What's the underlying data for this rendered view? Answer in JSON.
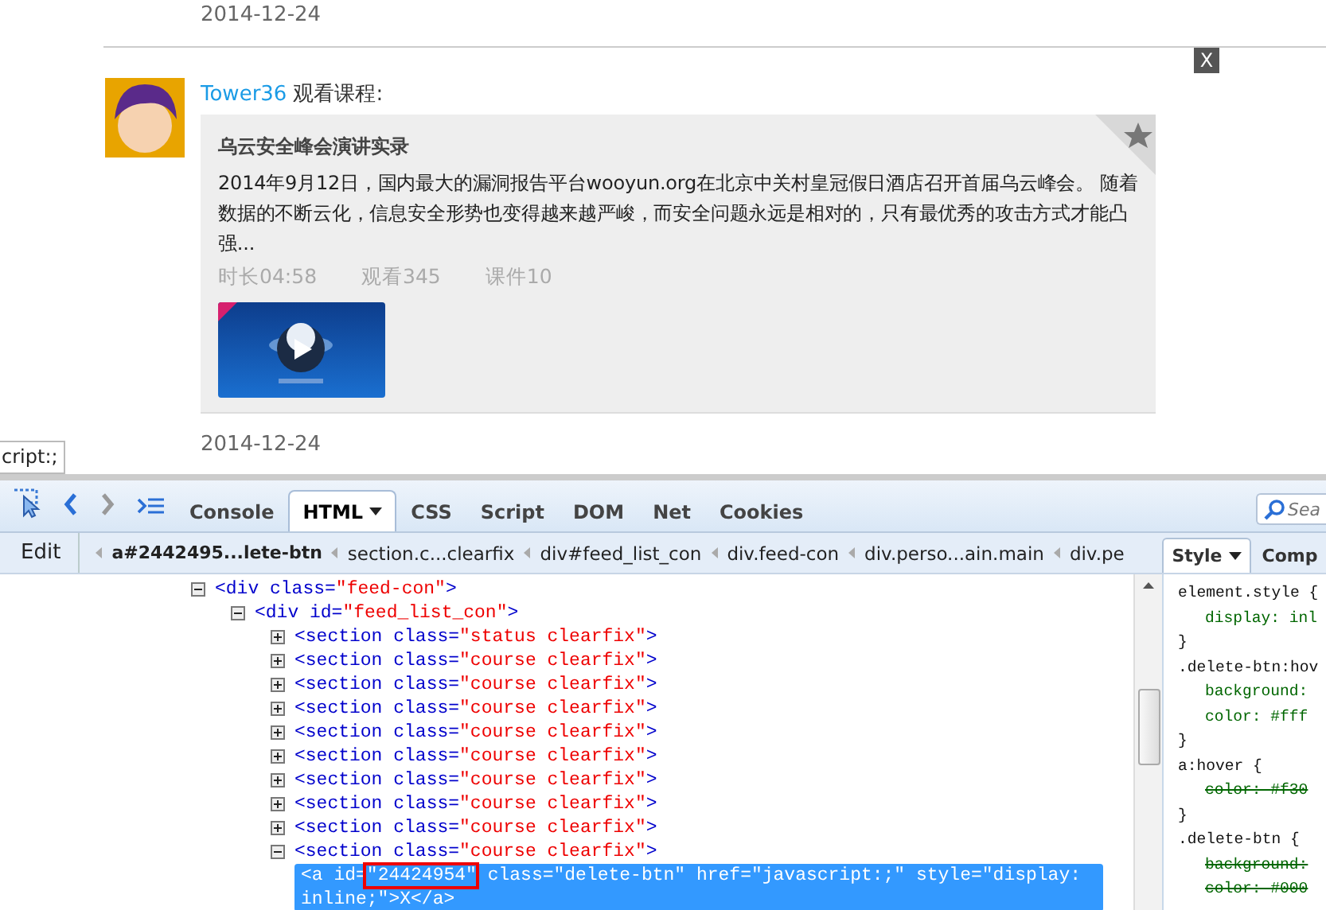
{
  "page": {
    "date_top": "2014-12-24",
    "close_label": "X",
    "feed": {
      "user": "Tower36",
      "action": "观看课程:",
      "course": {
        "title": "乌云安全峰会演讲实录",
        "description": "2014年9月12日，国内最大的漏洞报告平台wooyun.org在北京中关村皇冠假日酒店召开首届乌云峰会。 随着数据的不断云化，信息安全形势也变得越来越严峻，而安全问题永远是相对的，只有最优秀的攻击方式才能凸强...",
        "stats": [
          "时长04:58",
          "观看345",
          "课件10"
        ],
        "thumbnail": {
          "kind": "picture"
        }
      }
    },
    "date_bottom": "2014-12-24",
    "tooltip": "cript:;"
  },
  "devtools": {
    "tabs": [
      {
        "label": "Console",
        "selected": false,
        "menu": false
      },
      {
        "label": "HTML",
        "selected": true,
        "menu": true
      },
      {
        "label": "CSS",
        "selected": false,
        "menu": false
      },
      {
        "label": "Script",
        "selected": false,
        "menu": false
      },
      {
        "label": "DOM",
        "selected": false,
        "menu": false
      },
      {
        "label": "Net",
        "selected": false,
        "menu": false
      },
      {
        "label": "Cookies",
        "selected": false,
        "menu": false
      }
    ],
    "forward_disabled": true,
    "search_placeholder": "Sea",
    "edit_label": "Edit",
    "breadcrumbs": [
      {
        "label": "a#2442495...lete-btn",
        "selected": true
      },
      {
        "label": "section.c...clearfix",
        "selected": false
      },
      {
        "label": "div#feed_list_con",
        "selected": false
      },
      {
        "label": "div.feed-con",
        "selected": false
      },
      {
        "label": "div.perso...ain.main",
        "selected": false
      },
      {
        "label": "div.pe",
        "selected": false
      }
    ],
    "side_tabs": [
      {
        "label": "Style",
        "selected": true,
        "menu": true
      },
      {
        "label": "Comp",
        "selected": false,
        "menu": false
      }
    ],
    "tree": [
      {
        "expanded": true,
        "selected": false,
        "parts": [
          {
            "text": "<div class=",
            "kind": "tag"
          },
          {
            "text": "\"feed-con\"",
            "kind": "value"
          },
          {
            "text": ">",
            "kind": "tag"
          }
        ],
        "children": [
          {
            "expanded": true,
            "selected": false,
            "parts": [
              {
                "text": "<div id=",
                "kind": "tag"
              },
              {
                "text": "\"feed_list_con\"",
                "kind": "value"
              },
              {
                "text": ">",
                "kind": "tag"
              }
            ],
            "children": [
              {
                "expanded": false,
                "selected": false,
                "parts": [
                  {
                    "text": "<section class=",
                    "kind": "tag"
                  },
                  {
                    "text": "\"status clearfix\"",
                    "kind": "value"
                  },
                  {
                    "text": ">",
                    "kind": "tag"
                  }
                ]
              },
              {
                "expanded": false,
                "selected": false,
                "parts": [
                  {
                    "text": "<section class=",
                    "kind": "tag"
                  },
                  {
                    "text": "\"course clearfix\"",
                    "kind": "value"
                  },
                  {
                    "text": ">",
                    "kind": "tag"
                  }
                ]
              },
              {
                "expanded": false,
                "selected": false,
                "parts": [
                  {
                    "text": "<section class=",
                    "kind": "tag"
                  },
                  {
                    "text": "\"course clearfix\"",
                    "kind": "value"
                  },
                  {
                    "text": ">",
                    "kind": "tag"
                  }
                ]
              },
              {
                "expanded": false,
                "selected": false,
                "parts": [
                  {
                    "text": "<section class=",
                    "kind": "tag"
                  },
                  {
                    "text": "\"course clearfix\"",
                    "kind": "value"
                  },
                  {
                    "text": ">",
                    "kind": "tag"
                  }
                ]
              },
              {
                "expanded": false,
                "selected": false,
                "parts": [
                  {
                    "text": "<section class=",
                    "kind": "tag"
                  },
                  {
                    "text": "\"course clearfix\"",
                    "kind": "value"
                  },
                  {
                    "text": ">",
                    "kind": "tag"
                  }
                ]
              },
              {
                "expanded": false,
                "selected": false,
                "parts": [
                  {
                    "text": "<section class=",
                    "kind": "tag"
                  },
                  {
                    "text": "\"course clearfix\"",
                    "kind": "value"
                  },
                  {
                    "text": ">",
                    "kind": "tag"
                  }
                ]
              },
              {
                "expanded": false,
                "selected": false,
                "parts": [
                  {
                    "text": "<section class=",
                    "kind": "tag"
                  },
                  {
                    "text": "\"course clearfix\"",
                    "kind": "value"
                  },
                  {
                    "text": ">",
                    "kind": "tag"
                  }
                ]
              },
              {
                "expanded": false,
                "selected": false,
                "parts": [
                  {
                    "text": "<section class=",
                    "kind": "tag"
                  },
                  {
                    "text": "\"course clearfix\"",
                    "kind": "value"
                  },
                  {
                    "text": ">",
                    "kind": "tag"
                  }
                ]
              },
              {
                "expanded": false,
                "selected": false,
                "parts": [
                  {
                    "text": "<section class=",
                    "kind": "tag"
                  },
                  {
                    "text": "\"course clearfix\"",
                    "kind": "value"
                  },
                  {
                    "text": ">",
                    "kind": "tag"
                  }
                ]
              },
              {
                "expanded": true,
                "selected": false,
                "parts": [
                  {
                    "text": "<section class=",
                    "kind": "tag"
                  },
                  {
                    "text": "\"course clearfix\"",
                    "kind": "value"
                  },
                  {
                    "text": ">",
                    "kind": "tag"
                  }
                ],
                "children": [
                  {
                    "selected": true,
                    "parts": [
                      {
                        "text": "<a id="
                      },
                      {
                        "text": "\"24424954\"",
                        "highlighted": true
                      },
                      {
                        "text": " class=\"delete-btn\" href=\"javascript:;\" style=\"display: inline;\">X</a>"
                      }
                    ]
                  }
                ]
              }
            ]
          }
        ]
      }
    ],
    "style_rules": [
      {
        "selector": "element.style {",
        "decls": [
          {
            "text": "display: inl",
            "overridden": false
          }
        ],
        "close": "}"
      },
      {
        "selector": ".delete-btn:hov",
        "decls": [
          {
            "text": "background:",
            "overridden": false
          },
          {
            "text": "color: #fff",
            "overridden": false
          }
        ],
        "close": "}"
      },
      {
        "selector": "a:hover {",
        "decls": [
          {
            "text": "color: #f30",
            "overridden": true
          }
        ],
        "close": "}"
      },
      {
        "selector": ".delete-btn {",
        "decls": [
          {
            "text": "background:",
            "overridden": true
          },
          {
            "text": "color: #000",
            "overridden": true
          }
        ]
      }
    ]
  }
}
